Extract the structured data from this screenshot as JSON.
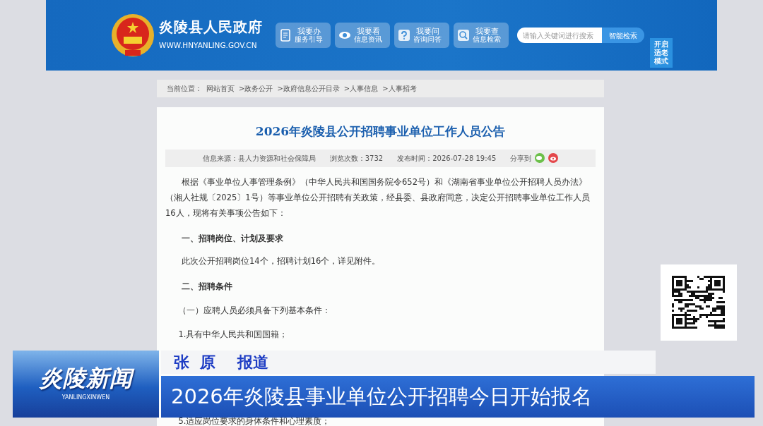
{
  "header": {
    "site_title": "炎陵县人民政府",
    "site_url": "WWW.HNYANLING.GOV.CN",
    "nav_buttons": [
      {
        "kind": "doc",
        "title": "我要办",
        "subtitle": "服务引导"
      },
      {
        "kind": "eye",
        "title": "我要看",
        "subtitle": "信息资讯"
      },
      {
        "kind": "question",
        "title": "我要问",
        "subtitle": "咨询问答"
      },
      {
        "kind": "search",
        "title": "我要查",
        "subtitle": "信息检索"
      }
    ],
    "search": {
      "placeholder": "请输入关键词进行搜索",
      "button": "智能检索"
    },
    "elder_mode": "开启适老模式"
  },
  "breadcrumb": {
    "label": "当前位置：",
    "items": [
      "网站首页",
      ">政务公开",
      ">政府信息公开目录",
      ">人事信息",
      ">人事招考"
    ]
  },
  "article": {
    "title": "2026年炎陵县公开招聘事业单位工作人员公告",
    "meta": [
      "信息来源：县人力资源和社会保障局",
      "浏览次数：3732",
      "发布时间：2026-07-28 19:45"
    ],
    "share_label": "分享到",
    "paragraphs": [
      {
        "kind": "body",
        "text": "根据《事业单位人事管理条例》（中华人民共和国国务院令652号）和《湖南省事业单位公开招聘人员办法》（湘人社规〔2025〕1号）等事业单位公开招聘有关政策，经县委、县政府同意，决定公开招聘事业单位工作人员16人，现将有关事项公告如下："
      },
      {
        "kind": "heading",
        "text": "一、招聘岗位、计划及要求"
      },
      {
        "kind": "body",
        "text": "此次公开招聘岗位14个，招聘计划16个，详见附件。"
      },
      {
        "kind": "heading",
        "text": "二、招聘条件"
      },
      {
        "kind": "sub",
        "text": "（一）应聘人员必须具备下列基本条件："
      },
      {
        "kind": "item",
        "text": "1.具有中华人民共和国国籍；"
      },
      {
        "kind": "item",
        "text": "5.适应岗位要求的身体条件和心理素质；"
      }
    ]
  },
  "news_overlay": {
    "logo": "炎陵新闻",
    "logo_pinyin": "YANLINGXINWEN",
    "reporter": "张  原    报道",
    "headline": "2026年炎陵县事业单位公开招聘今日开始报名"
  }
}
